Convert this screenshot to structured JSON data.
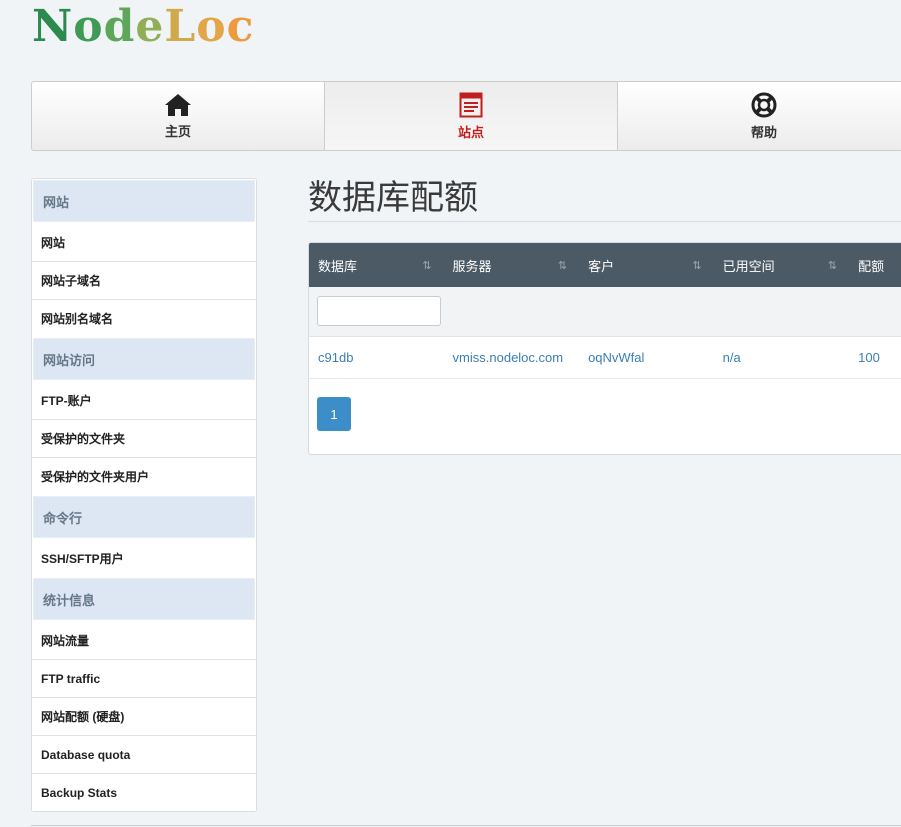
{
  "brand": {
    "letters": [
      {
        "char": "N",
        "color": "#2d8a4e"
      },
      {
        "char": "o",
        "color": "#3f9a55"
      },
      {
        "char": "d",
        "color": "#5ea65a"
      },
      {
        "char": "e",
        "color": "#8fae55"
      },
      {
        "char": "L",
        "color": "#cfa94a"
      },
      {
        "char": "o",
        "color": "#e2a548"
      },
      {
        "char": "c",
        "color": "#ee9a3e"
      }
    ]
  },
  "nav": {
    "items": [
      {
        "label": "主页",
        "icon": "home-icon",
        "active": false
      },
      {
        "label": "站点",
        "icon": "sites-icon",
        "active": true
      },
      {
        "label": "帮助",
        "icon": "help-lifebuoy-icon",
        "active": false
      }
    ],
    "active_color": "#c11e1e"
  },
  "sidebar": {
    "groups": [
      {
        "title": "网站",
        "items": [
          "网站",
          "网站子域名",
          "网站别名域名"
        ]
      },
      {
        "title": "网站访问",
        "items": [
          "FTP-账户",
          "受保护的文件夹",
          "受保护的文件夹用户"
        ]
      },
      {
        "title": "命令行",
        "items": [
          "SSH/SFTP用户"
        ]
      },
      {
        "title": "统计信息",
        "items": [
          "网站流量",
          "FTP traffic",
          "网站配额 (硬盘)",
          "Database quota",
          "Backup Stats"
        ]
      }
    ]
  },
  "main": {
    "title": "数据库配额",
    "table": {
      "columns": [
        "数据库",
        "服务器",
        "客户",
        "已用空间",
        "配额"
      ],
      "sort_glyph": "⇅",
      "filter_value": "",
      "rows": [
        [
          "c91db",
          "vmiss.nodeloc.com",
          "oqNvWfal",
          "n/a",
          "100"
        ]
      ]
    },
    "pagination": {
      "current_page": "1"
    }
  }
}
